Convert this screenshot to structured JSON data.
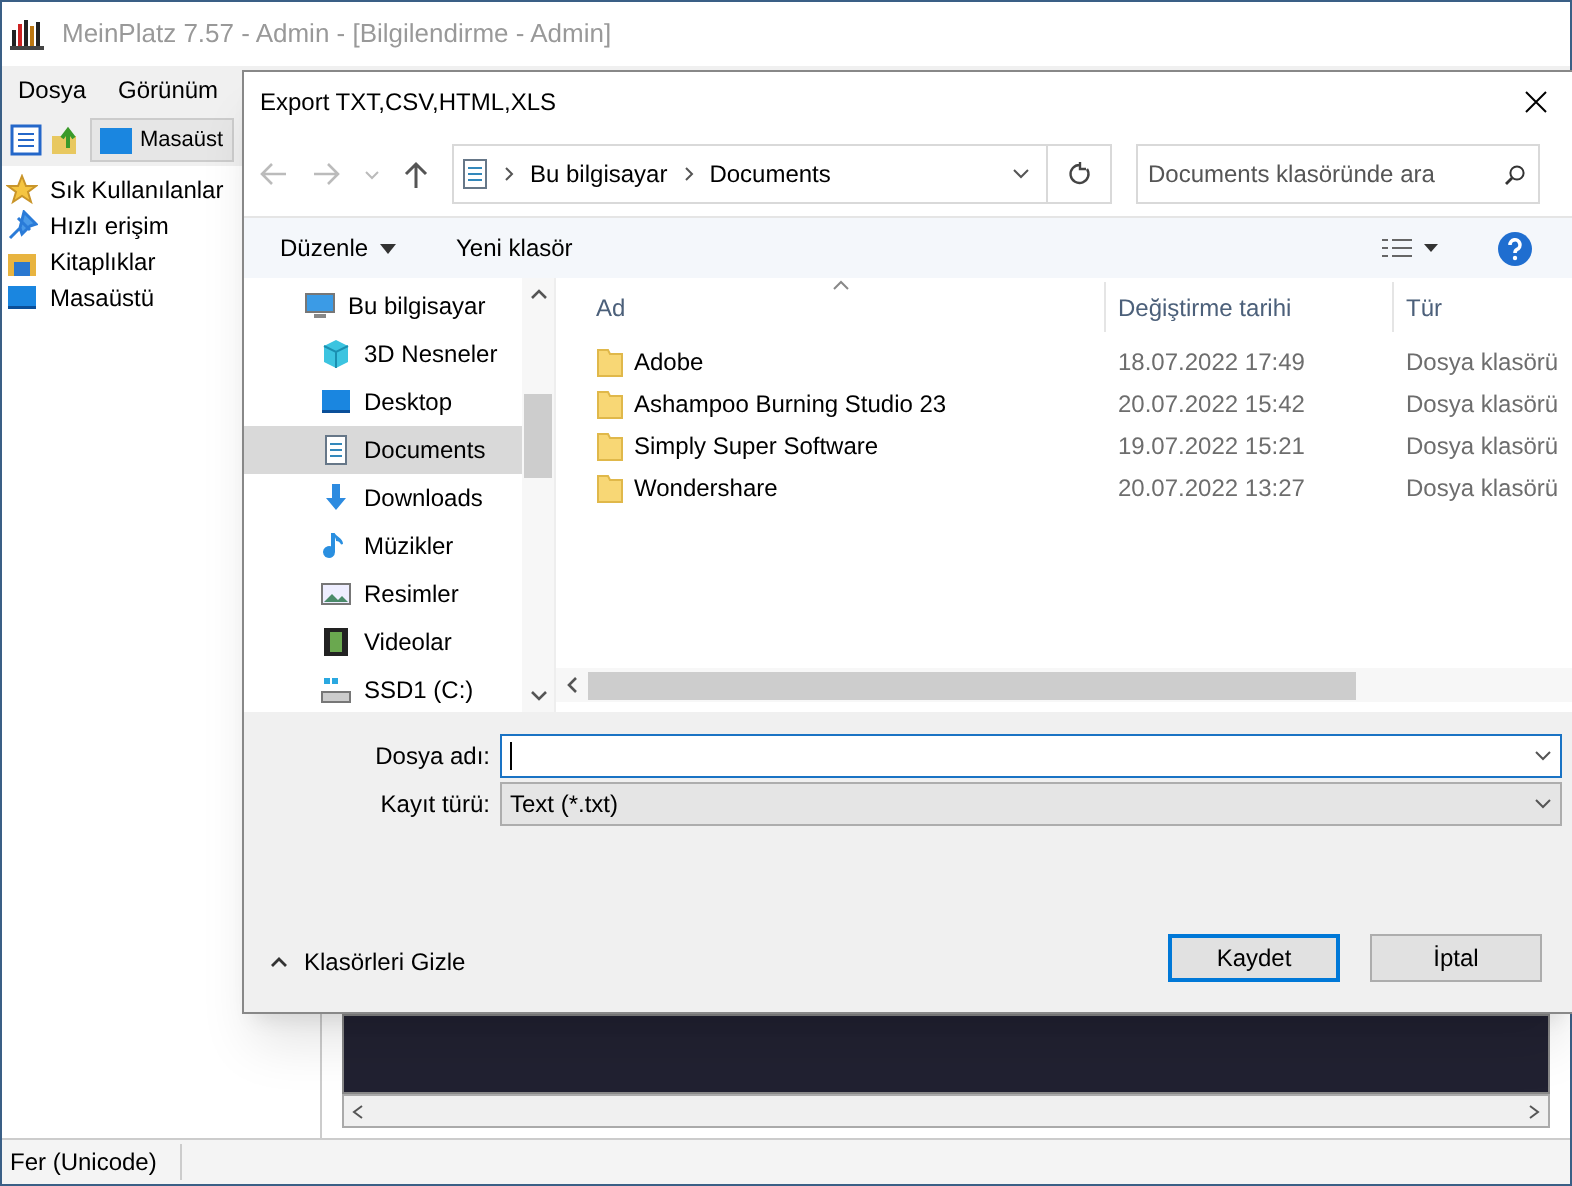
{
  "app": {
    "title": "MeinPlatz 7.57 - Admin - [Bilgilendirme - Admin]",
    "menu": [
      "Dosya",
      "Görünüm"
    ],
    "address": "Masaüst",
    "tree": [
      {
        "label": "Sık Kullanılanlar",
        "kind": "star"
      },
      {
        "label": "Hızlı erişim",
        "kind": "pin"
      },
      {
        "label": "Kitaplıklar",
        "kind": "library"
      },
      {
        "label": "Masaüstü",
        "kind": "desktop"
      }
    ],
    "status_bar": "Fer (Unicode)"
  },
  "dialog": {
    "title": "Export TXT,CSV,HTML,XLS",
    "breadcrumb": [
      "Bu bilgisayar",
      "Documents"
    ],
    "search": {
      "placeholder": "Documents klasöründe ara"
    },
    "toolbar": [
      "Düzenle",
      "Yeni klasör"
    ],
    "nav_pane": [
      {
        "label": "Bu bilgisayar",
        "kind": "pc",
        "selected": false,
        "children": [
          {
            "label": "3D Nesneler",
            "kind": "cube",
            "selected": false
          },
          {
            "label": "Desktop",
            "kind": "desktop",
            "selected": false
          },
          {
            "label": "Documents",
            "kind": "doc",
            "selected": true
          },
          {
            "label": "Downloads",
            "kind": "download",
            "selected": false
          },
          {
            "label": "Müzikler",
            "kind": "music",
            "selected": false
          },
          {
            "label": "Resimler",
            "kind": "image",
            "selected": false
          },
          {
            "label": "Videolar",
            "kind": "video",
            "selected": false
          },
          {
            "label": "SSD1 (C:)",
            "kind": "drive",
            "selected": false
          }
        ]
      }
    ],
    "columns": [
      "Ad",
      "Değiştirme tarihi",
      "Tür"
    ],
    "rows": [
      [
        "Adobe",
        "18.07.2022 17:49",
        "Dosya klasörü"
      ],
      [
        "Ashampoo Burning Studio 23",
        "20.07.2022 15:42",
        "Dosya klasörü"
      ],
      [
        "Simply Super Software",
        "19.07.2022 15:21",
        "Dosya klasörü"
      ],
      [
        "Wondershare",
        "20.07.2022 13:27",
        "Dosya klasörü"
      ]
    ],
    "file_name": {
      "label": "Dosya adı:"
    },
    "file_type": {
      "label": "Kayıt türü:",
      "value": "Text (*.txt)"
    },
    "hide_folders": "Klasörleri Gizle",
    "buttons": [
      {
        "label": "Kaydet",
        "default": true
      },
      {
        "label": "İptal",
        "default": false
      }
    ]
  }
}
